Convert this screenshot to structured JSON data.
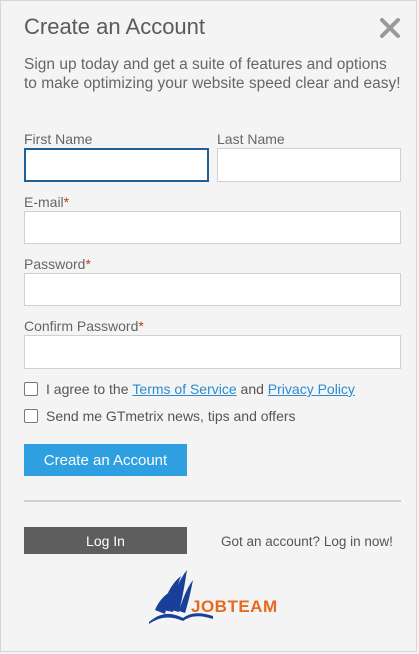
{
  "modal": {
    "title": "Create an Account",
    "intro": "Sign up today and get a suite of features and options to make optimizing your website speed clear and easy!"
  },
  "form": {
    "first_name_label": "First Name",
    "last_name_label": "Last Name",
    "email_label": "E-mail",
    "password_label": "Password",
    "confirm_password_label": "Confirm Password",
    "required_mark": "*",
    "first_name_value": "",
    "last_name_value": "",
    "email_value": "",
    "password_value": "",
    "confirm_password_value": ""
  },
  "agree": {
    "prefix": "I agree to the",
    "terms": "Terms of Service",
    "and": "and",
    "privacy": "Privacy Policy"
  },
  "newsletter_label": "Send me GTmetrix news, tips and offers",
  "create_button": "Create an Account",
  "login_button": "Log In",
  "login_prompt": "Got an account? Log in now!",
  "logo_text": "JOBTEAM",
  "colors": {
    "accent": "#2e9fe0",
    "link": "#2a8bcf",
    "login_button": "#5e5e5e",
    "required": "#c0392b",
    "logo_blue": "#1a3f9a",
    "logo_orange": "#e46a1e"
  }
}
